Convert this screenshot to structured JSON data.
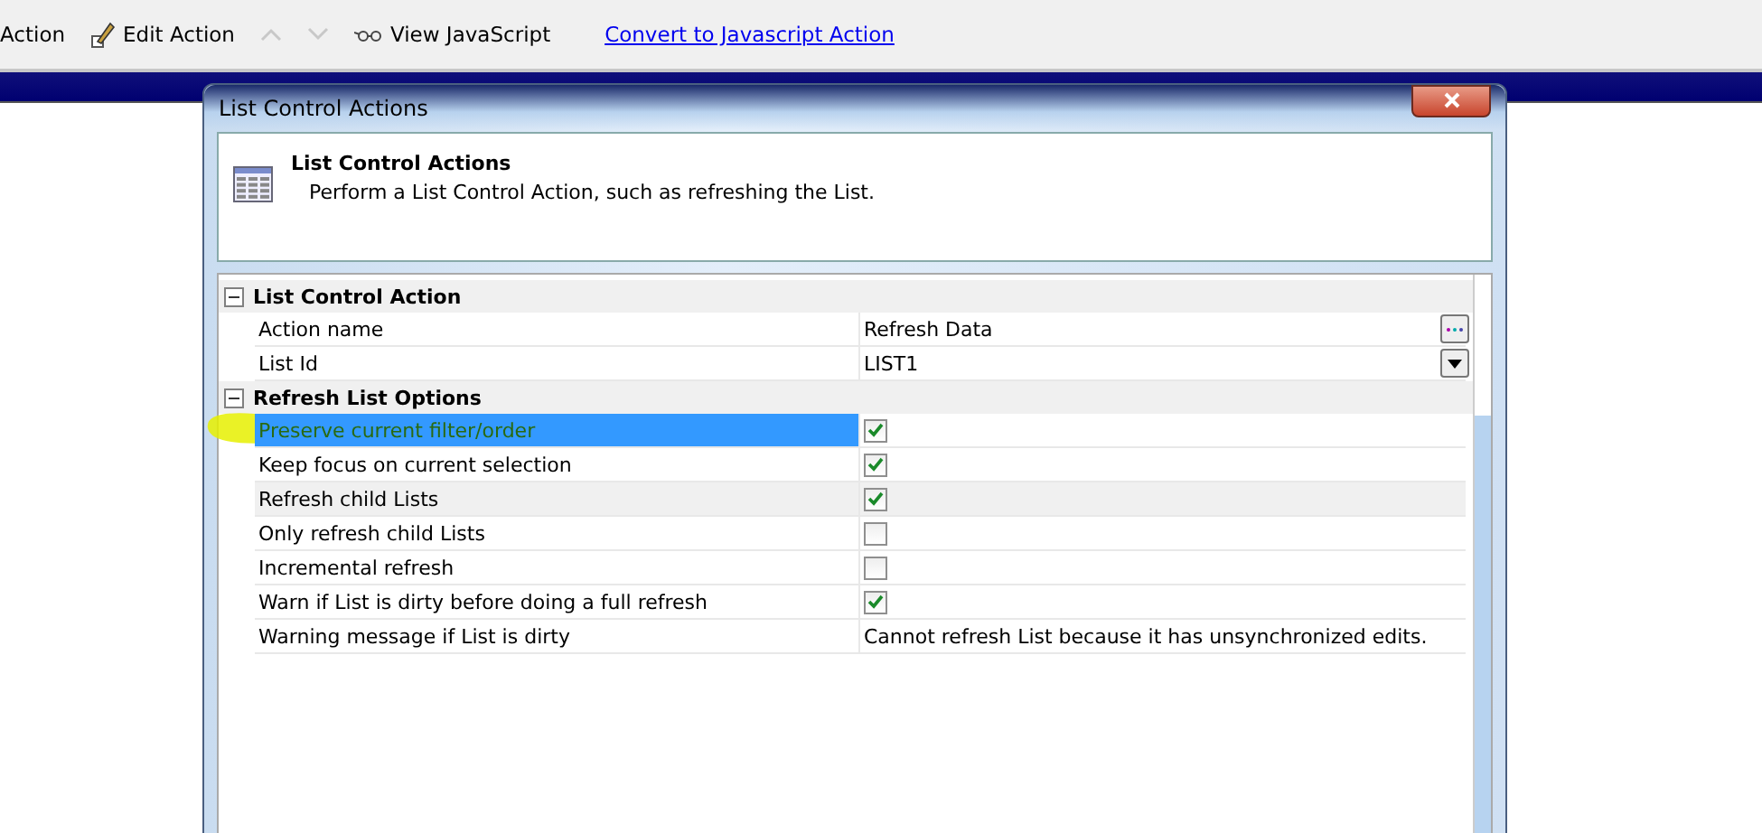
{
  "toolbar": [
    {
      "kind": "text",
      "label": "Action"
    },
    {
      "kind": "pencil",
      "label": "Edit Action"
    },
    {
      "kind": "up",
      "disabled": true
    },
    {
      "kind": "down",
      "disabled": true
    },
    {
      "kind": "glasses",
      "label": "View JavaScript"
    },
    {
      "kind": "link",
      "label": "Convert to Javascript Action"
    }
  ],
  "dialog": {
    "title": "List Control Actions",
    "header": {
      "title": "List Control Actions",
      "description": "Perform a List Control Action, such as refreshing the List."
    },
    "categories": [
      {
        "name": "List Control Action",
        "expanded": true,
        "properties": [
          {
            "kind": "text",
            "label": "Action name",
            "value": "Refresh Data",
            "editor": {
              "kind": "ellipsis"
            },
            "selected": false,
            "shaded": false
          },
          {
            "kind": "text",
            "label": "List Id",
            "value": "LIST1",
            "editor": {
              "kind": "dropdown"
            },
            "selected": false,
            "shaded": false
          }
        ]
      },
      {
        "name": "Refresh List Options",
        "expanded": true,
        "properties": [
          {
            "kind": "checkbox",
            "label": "Preserve current filter/order",
            "checked": true,
            "selected": true,
            "highlighted": true,
            "shaded": false
          },
          {
            "kind": "checkbox",
            "label": "Keep focus on current selection",
            "checked": true,
            "selected": false,
            "shaded": false
          },
          {
            "kind": "checkbox",
            "label": "Refresh child Lists",
            "checked": true,
            "selected": false,
            "shaded": true
          },
          {
            "kind": "checkbox",
            "label": "Only refresh child Lists",
            "checked": false,
            "selected": false,
            "shaded": false
          },
          {
            "kind": "checkbox",
            "label": "Incremental refresh",
            "checked": false,
            "selected": false,
            "shaded": false
          },
          {
            "kind": "checkbox",
            "label": "Warn if List is dirty before doing a full refresh",
            "checked": true,
            "selected": false,
            "shaded": false
          },
          {
            "kind": "text",
            "label": "Warning message if List is dirty",
            "value": "Cannot refresh List because it has unsynchronized edits.",
            "selected": false,
            "shaded": false
          }
        ]
      }
    ]
  }
}
